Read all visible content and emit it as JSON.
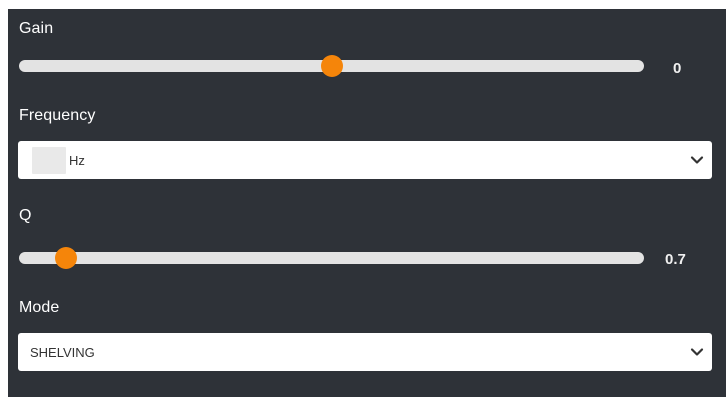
{
  "colors": {
    "panel_bg": "#2e3238",
    "accent": "#f5850a",
    "track": "#e3e3e3"
  },
  "gain": {
    "label": "Gain",
    "value_text": "0",
    "level": 0.5
  },
  "frequency": {
    "label": "Frequency",
    "input_value": "",
    "unit": "Hz",
    "icon": "chevron-down-icon"
  },
  "q": {
    "label": "Q",
    "value_text": "0.7",
    "level": 0.075
  },
  "mode": {
    "label": "Mode",
    "selected": "SHELVING",
    "icon": "chevron-down-icon"
  }
}
